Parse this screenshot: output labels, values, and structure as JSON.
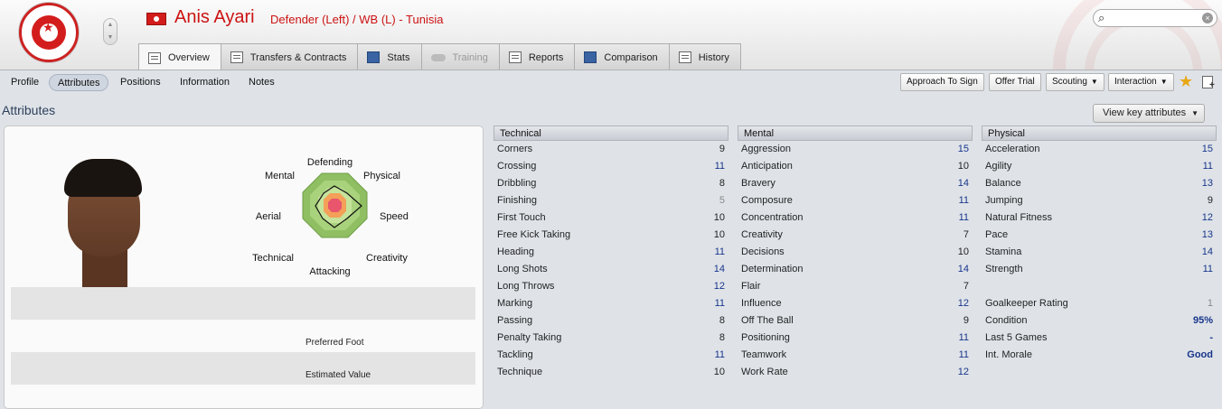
{
  "header": {
    "player_name": "Anis Ayari",
    "player_role": "Defender (Left) / WB (L) - Tunisia",
    "search_placeholder": ""
  },
  "tabs": [
    {
      "label": "Overview",
      "active": true
    },
    {
      "label": "Transfers & Contracts"
    },
    {
      "label": "Stats"
    },
    {
      "label": "Training",
      "disabled": true
    },
    {
      "label": "Reports"
    },
    {
      "label": "Comparison"
    },
    {
      "label": "History"
    }
  ],
  "subnav": {
    "items": [
      "Profile",
      "Attributes",
      "Positions",
      "Information",
      "Notes"
    ],
    "approach_label": "Approach To Sign",
    "trial_label": "Offer Trial",
    "scouting_label": "Scouting",
    "interaction_label": "Interaction"
  },
  "section_title": "Attributes",
  "view_key_label": "View key attributes",
  "radar": {
    "labels": {
      "defending": "Defending",
      "physical": "Physical",
      "speed": "Speed",
      "creativity": "Creativity",
      "attacking": "Attacking",
      "technical": "Technical",
      "aerial": "Aerial",
      "mental": "Mental"
    }
  },
  "profile": {
    "preferred_foot_label": "Preferred Foot",
    "estimated_value_label": "Estimated Value"
  },
  "technical": {
    "title": "Technical",
    "rows": [
      {
        "name": "Corners",
        "value": "9"
      },
      {
        "name": "Crossing",
        "value": "11"
      },
      {
        "name": "Dribbling",
        "value": "8"
      },
      {
        "name": "Finishing",
        "value": "5"
      },
      {
        "name": "First Touch",
        "value": "10"
      },
      {
        "name": "Free Kick Taking",
        "value": "10"
      },
      {
        "name": "Heading",
        "value": "11"
      },
      {
        "name": "Long Shots",
        "value": "14"
      },
      {
        "name": "Long Throws",
        "value": "12"
      },
      {
        "name": "Marking",
        "value": "11"
      },
      {
        "name": "Passing",
        "value": "8"
      },
      {
        "name": "Penalty Taking",
        "value": "8"
      },
      {
        "name": "Tackling",
        "value": "11"
      },
      {
        "name": "Technique",
        "value": "10"
      }
    ]
  },
  "mental": {
    "title": "Mental",
    "rows": [
      {
        "name": "Aggression",
        "value": "15"
      },
      {
        "name": "Anticipation",
        "value": "10"
      },
      {
        "name": "Bravery",
        "value": "14"
      },
      {
        "name": "Composure",
        "value": "11"
      },
      {
        "name": "Concentration",
        "value": "11"
      },
      {
        "name": "Creativity",
        "value": "7"
      },
      {
        "name": "Decisions",
        "value": "10"
      },
      {
        "name": "Determination",
        "value": "14"
      },
      {
        "name": "Flair",
        "value": "7"
      },
      {
        "name": "Influence",
        "value": "12"
      },
      {
        "name": "Off The Ball",
        "value": "9"
      },
      {
        "name": "Positioning",
        "value": "11"
      },
      {
        "name": "Teamwork",
        "value": "11"
      },
      {
        "name": "Work Rate",
        "value": "12"
      }
    ]
  },
  "physical": {
    "title": "Physical",
    "rows": [
      {
        "name": "Acceleration",
        "value": "15"
      },
      {
        "name": "Agility",
        "value": "11"
      },
      {
        "name": "Balance",
        "value": "13"
      },
      {
        "name": "Jumping",
        "value": "9"
      },
      {
        "name": "Natural Fitness",
        "value": "12"
      },
      {
        "name": "Pace",
        "value": "13"
      },
      {
        "name": "Stamina",
        "value": "14"
      },
      {
        "name": "Strength",
        "value": "11"
      }
    ],
    "extra": [
      {
        "name": "Goalkeeper Rating",
        "value": "1"
      },
      {
        "name": "Condition",
        "value": "95%"
      },
      {
        "name": "Last 5 Games",
        "value": "-"
      },
      {
        "name": "Int. Morale",
        "value": "Good"
      }
    ]
  },
  "colors": {
    "accent_red": "#cc1313",
    "value_blue": "#17358a",
    "radar_outer": "#8fbf62",
    "radar_mid": "#a9d27c",
    "radar_inner": "#f4a058",
    "radar_core": "#e8556d"
  }
}
